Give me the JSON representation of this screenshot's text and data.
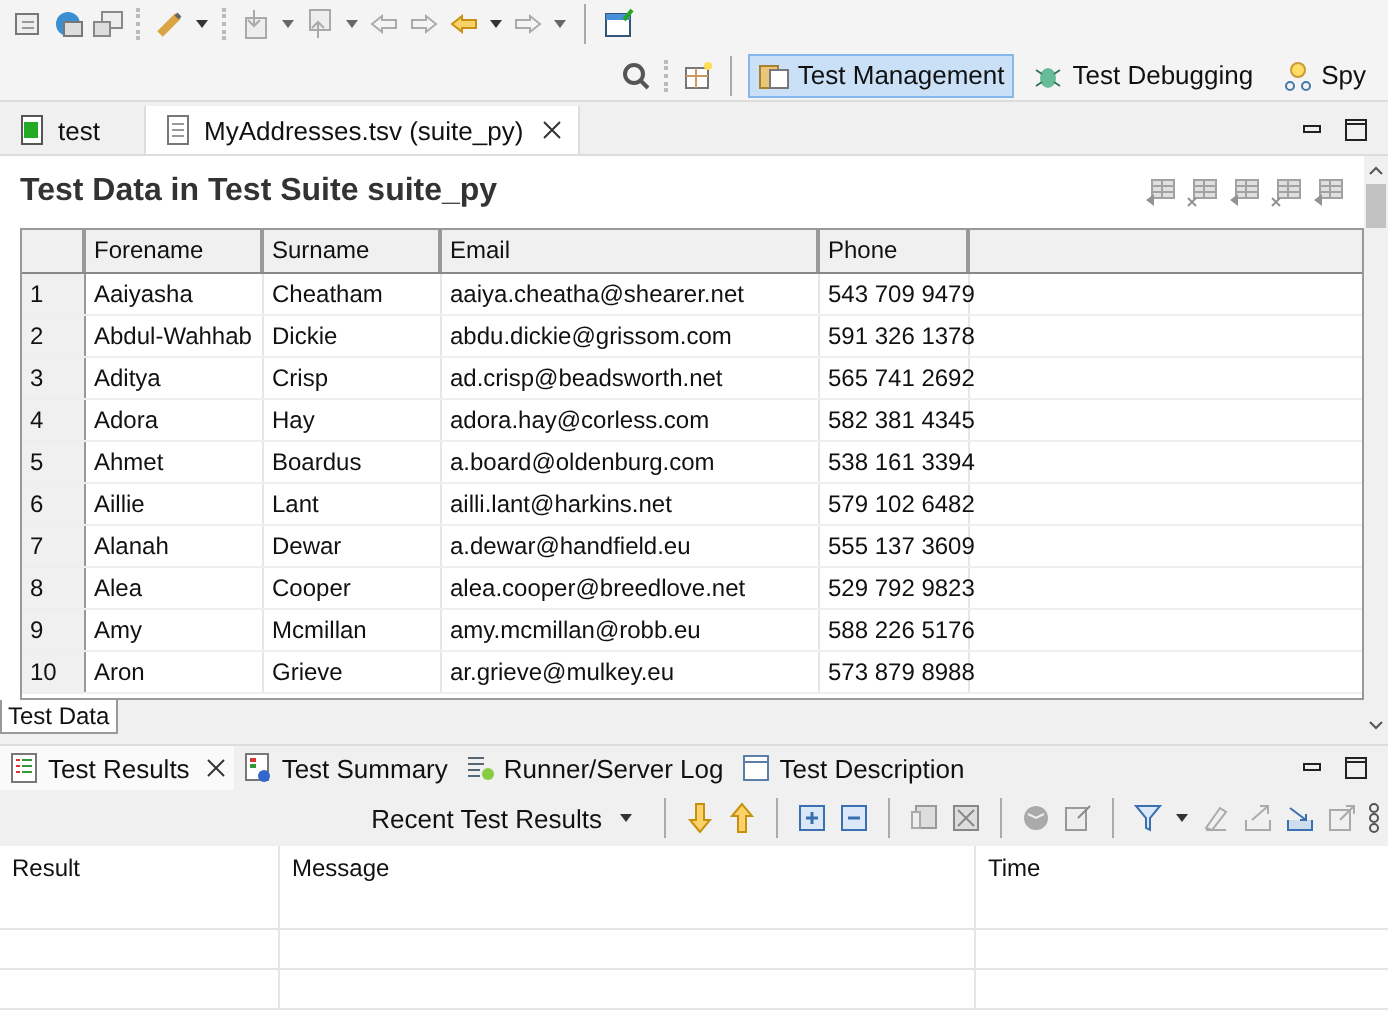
{
  "perspectives": [
    {
      "label": "Test Management",
      "selected": true
    },
    {
      "label": "Test Debugging",
      "selected": false
    },
    {
      "label": "Spy",
      "selected": false
    }
  ],
  "editor_tabs": [
    {
      "label": "test",
      "selected": false
    },
    {
      "label": "MyAddresses.tsv (suite_py)",
      "selected": true
    }
  ],
  "editor": {
    "title": "Test Data in Test Suite suite_py",
    "columns": [
      "",
      "Forename",
      "Surname",
      "Email",
      "Phone"
    ],
    "rows": [
      [
        "1",
        "Aaiyasha",
        "Cheatham",
        "aaiya.cheatha@shearer.net",
        "543 709 9479"
      ],
      [
        "2",
        "Abdul-Wahhab",
        "Dickie",
        "abdu.dickie@grissom.com",
        "591 326 1378"
      ],
      [
        "3",
        "Aditya",
        "Crisp",
        "ad.crisp@beadsworth.net",
        "565 741 2692"
      ],
      [
        "4",
        "Adora",
        "Hay",
        "adora.hay@corless.com",
        "582 381 4345"
      ],
      [
        "5",
        "Ahmet",
        "Boardus",
        "a.board@oldenburg.com",
        "538 161 3394"
      ],
      [
        "6",
        "Aillie",
        "Lant",
        "ailli.lant@harkins.net",
        "579 102 6482"
      ],
      [
        "7",
        "Alanah",
        "Dewar",
        "a.dewar@handfield.eu",
        "555 137 3609"
      ],
      [
        "8",
        "Alea",
        "Cooper",
        "alea.cooper@breedlove.net",
        "529 792 9823"
      ],
      [
        "9",
        "Amy",
        "Mcmillan",
        "amy.mcmillan@robb.eu",
        "588 226 5176"
      ],
      [
        "10",
        "Aron",
        "Grieve",
        "ar.grieve@mulkey.eu",
        "573 879 8988"
      ]
    ],
    "bottom_tab": "Test Data"
  },
  "panel_tabs": [
    {
      "label": "Test Results",
      "selected": true
    },
    {
      "label": "Test Summary",
      "selected": false
    },
    {
      "label": "Runner/Server Log",
      "selected": false
    },
    {
      "label": "Test Description",
      "selected": false
    }
  ],
  "results_dropdown": "Recent Test Results",
  "results_columns": [
    "Result",
    "Message",
    "Time"
  ]
}
